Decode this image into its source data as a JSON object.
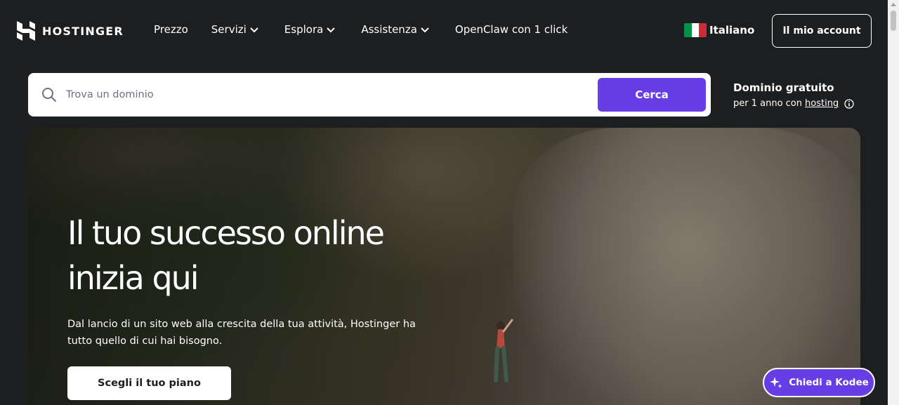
{
  "brand": {
    "name": "HOSTINGER",
    "accent": "#673de6",
    "background": "#1d1e20"
  },
  "nav": {
    "items": [
      {
        "label": "Prezzo",
        "dropdown": false
      },
      {
        "label": "Servizi",
        "dropdown": true
      },
      {
        "label": "Esplora",
        "dropdown": true
      },
      {
        "label": "Assistenza",
        "dropdown": true
      },
      {
        "label": "OpenClaw con 1 click",
        "dropdown": false
      }
    ],
    "language": {
      "label": "Italiano",
      "flag": "italy-flag-icon"
    },
    "account_label": "Il mio account"
  },
  "search": {
    "placeholder": "Trova un dominio",
    "value": "",
    "button_label": "Cerca",
    "icon": "search-icon"
  },
  "free_domain": {
    "title": "Dominio gratuito",
    "subtitle_prefix": "per 1 anno con",
    "link_label": "hosting",
    "icon": "info-icon"
  },
  "hero": {
    "title_line1": "Il tuo successo online",
    "title_line2": "inizia qui",
    "subtitle": "Dal lancio di un sito web alla crescita della tua attività, Hostinger ha tutto quello di cui hai bisogno.",
    "cta_label": "Scegli il tuo piano"
  },
  "chat": {
    "label": "Chiedi a Kodee",
    "icon": "sparkle-icon"
  }
}
